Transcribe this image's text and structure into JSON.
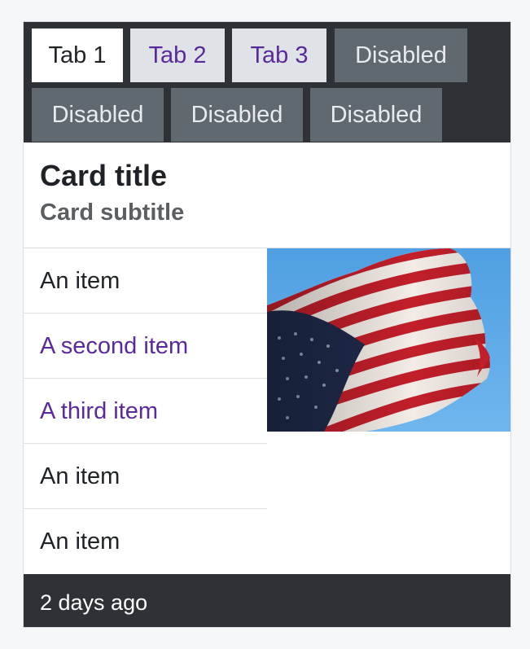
{
  "tabs": [
    {
      "label": "Tab 1",
      "state": "active"
    },
    {
      "label": "Tab 2",
      "state": "link"
    },
    {
      "label": "Tab 3",
      "state": "link"
    },
    {
      "label": "Disabled",
      "state": "disabled"
    },
    {
      "label": "Disabled",
      "state": "disabled"
    },
    {
      "label": "Disabled",
      "state": "disabled"
    },
    {
      "label": "Disabled",
      "state": "disabled"
    }
  ],
  "card": {
    "title": "Card title",
    "subtitle": "Card subtitle"
  },
  "list_items": [
    {
      "label": "An item",
      "style": "plain"
    },
    {
      "label": "A second item",
      "style": "link"
    },
    {
      "label": "A third item",
      "style": "link"
    },
    {
      "label": "An item",
      "style": "plain"
    },
    {
      "label": "An item",
      "style": "plain"
    }
  ],
  "image": {
    "subject": "american-flag"
  },
  "footer": {
    "text": "2 days ago"
  },
  "colors": {
    "header_bg": "#2e3236",
    "link": "#5a2a9a",
    "tab_link_bg": "#dfe3e8",
    "tab_disabled_bg": "#606870",
    "sky": "#5ea9e6"
  }
}
